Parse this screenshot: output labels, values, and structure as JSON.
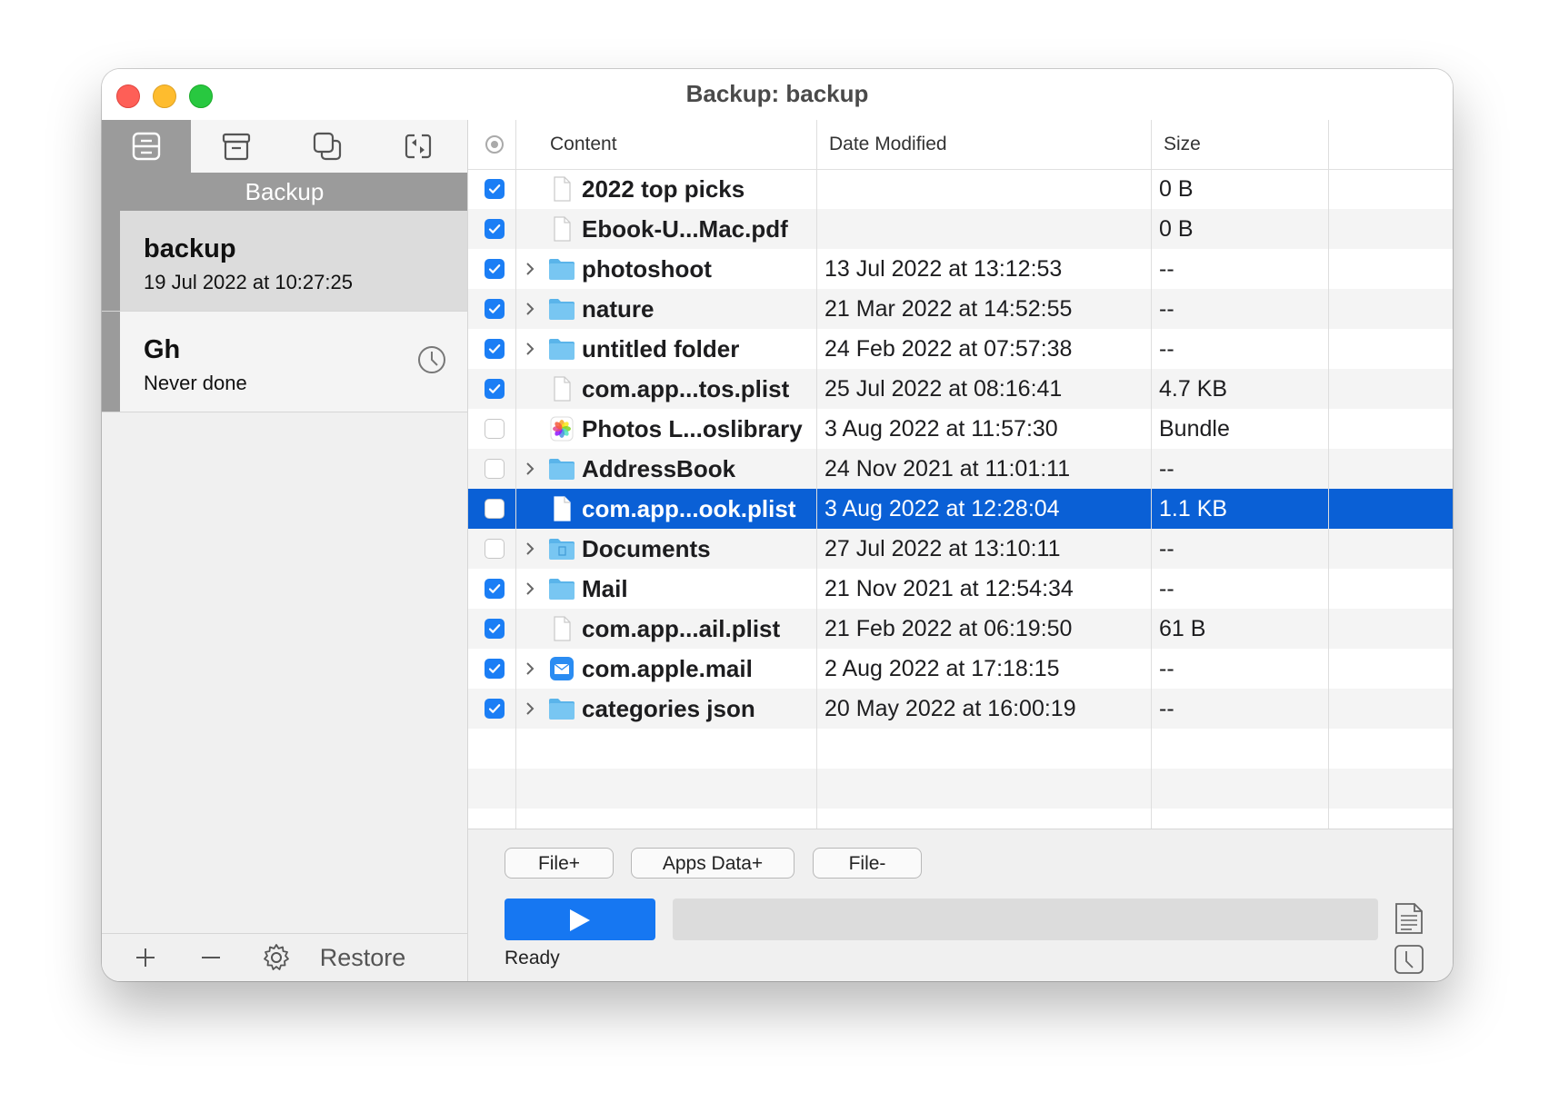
{
  "window": {
    "title": "Backup: backup"
  },
  "sidebar": {
    "tabs": [
      {
        "icon": "backup-drive-icon",
        "active": true
      },
      {
        "icon": "archive-box-icon",
        "active": false
      },
      {
        "icon": "clone-icon",
        "active": false
      },
      {
        "icon": "sync-icon",
        "active": false
      }
    ],
    "section_label": "Backup",
    "items": [
      {
        "name": "backup",
        "subtitle": "19 Jul 2022 at 10:27:25",
        "selected": true
      },
      {
        "name": "Gh",
        "subtitle": "Never done",
        "selected": false,
        "icon": "clock-icon"
      }
    ],
    "footer": {
      "add": "+",
      "remove": "−",
      "settings_icon": "gear-icon",
      "restore_label": "Restore"
    }
  },
  "table": {
    "columns": {
      "content": "Content",
      "date_modified": "Date Modified",
      "size": "Size"
    },
    "rows": [
      {
        "checked": true,
        "expandable": false,
        "icon": "file-icon",
        "name": "2022 top picks",
        "date": "",
        "size": "0 B"
      },
      {
        "checked": true,
        "expandable": false,
        "icon": "file-icon",
        "name": "Ebook-U...Mac.pdf",
        "date": "",
        "size": "0 B"
      },
      {
        "checked": true,
        "expandable": true,
        "icon": "folder-icon",
        "name": "photoshoot",
        "date": "13 Jul 2022 at 13:12:53",
        "size": "--"
      },
      {
        "checked": true,
        "expandable": true,
        "icon": "folder-icon",
        "name": "nature",
        "date": "21 Mar 2022 at 14:52:55",
        "size": "--"
      },
      {
        "checked": true,
        "expandable": true,
        "icon": "folder-icon",
        "name": "untitled folder",
        "date": "24 Feb 2022 at 07:57:38",
        "size": "--"
      },
      {
        "checked": true,
        "expandable": false,
        "icon": "file-icon",
        "name": "com.app...tos.plist",
        "date": "25 Jul 2022 at 08:16:41",
        "size": "4.7 KB"
      },
      {
        "checked": false,
        "expandable": false,
        "icon": "photos-app-icon",
        "name": "Photos L...oslibrary",
        "date": "3 Aug 2022 at 11:57:30",
        "size": "Bundle"
      },
      {
        "checked": false,
        "expandable": true,
        "icon": "folder-icon",
        "name": "AddressBook",
        "date": "24 Nov 2021 at 11:01:11",
        "size": "--"
      },
      {
        "checked": false,
        "expandable": false,
        "icon": "file-icon",
        "name": "com.app...ook.plist",
        "date": "3 Aug 2022 at 12:28:04",
        "size": "1.1 KB",
        "selected": true
      },
      {
        "checked": false,
        "expandable": true,
        "icon": "documents-folder-icon",
        "name": "Documents",
        "date": "27 Jul 2022 at 13:10:11",
        "size": "--"
      },
      {
        "checked": true,
        "expandable": true,
        "icon": "folder-icon",
        "name": "Mail",
        "date": "21 Nov 2021 at 12:54:34",
        "size": "--"
      },
      {
        "checked": true,
        "expandable": false,
        "icon": "file-icon",
        "name": "com.app...ail.plist",
        "date": "21 Feb 2022 at 06:19:50",
        "size": "61 B"
      },
      {
        "checked": true,
        "expandable": true,
        "icon": "mail-app-icon",
        "name": "com.apple.mail",
        "date": "2 Aug 2022 at 17:18:15",
        "size": "--"
      },
      {
        "checked": true,
        "expandable": true,
        "icon": "folder-icon",
        "name": "categories json",
        "date": "20 May 2022 at 16:00:19",
        "size": "--"
      }
    ]
  },
  "actions": {
    "file_add": "File+",
    "apps_data_add": "Apps Data+",
    "file_remove": "File-",
    "status": "Ready"
  },
  "colors": {
    "accent": "#1677f2",
    "selection": "#0a60d6",
    "sidebar_active": "#9b9b9b"
  }
}
